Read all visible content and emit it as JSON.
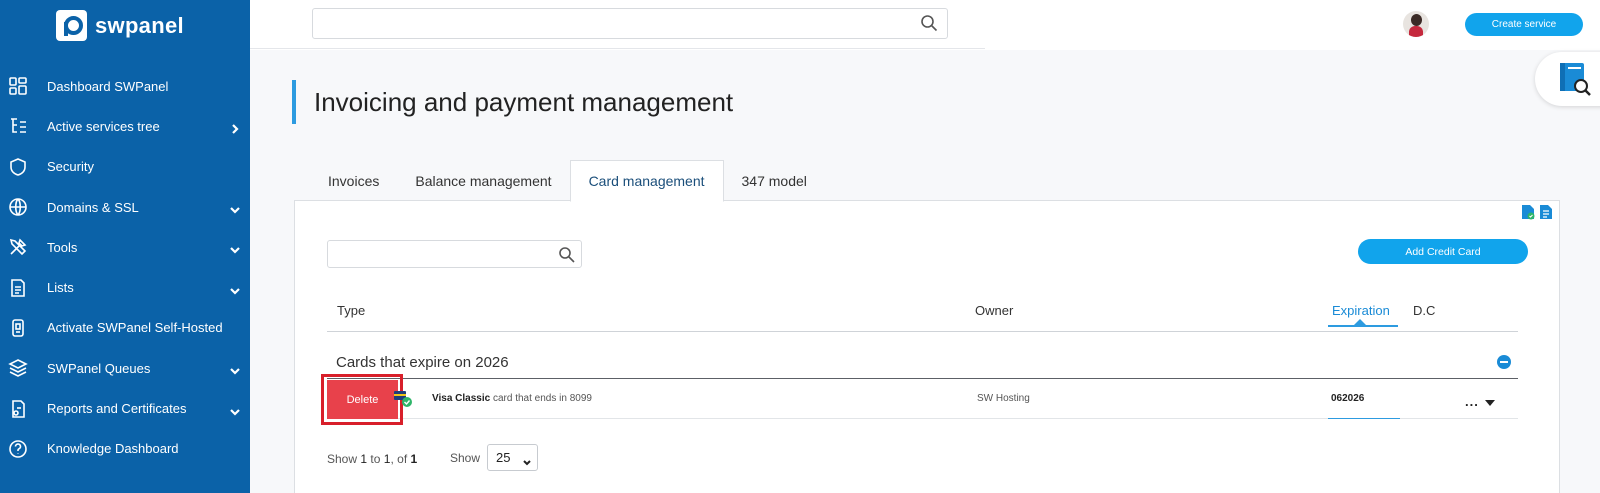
{
  "app": {
    "brand": "swpanel"
  },
  "sidebar": {
    "items": [
      {
        "label": "Dashboard SWPanel",
        "icon": "dashboard-icon",
        "arrow": "none"
      },
      {
        "label": "Active services tree",
        "icon": "tree-icon",
        "arrow": "right"
      },
      {
        "label": "Security",
        "icon": "shield-icon",
        "arrow": "none"
      },
      {
        "label": "Domains & SSL",
        "icon": "www-icon",
        "arrow": "down"
      },
      {
        "label": "Tools",
        "icon": "tools-icon",
        "arrow": "down"
      },
      {
        "label": "Lists",
        "icon": "list-icon",
        "arrow": "down"
      },
      {
        "label": "Activate SWPanel Self-Hosted",
        "icon": "self-hosted-icon",
        "arrow": "none"
      },
      {
        "label": "SWPanel Queues",
        "icon": "layers-icon",
        "arrow": "down"
      },
      {
        "label": "Reports and Certificates",
        "icon": "report-icon",
        "arrow": "down"
      },
      {
        "label": "Knowledge Dashboard",
        "icon": "help-icon",
        "arrow": "none"
      }
    ]
  },
  "topbar": {
    "search_placeholder": "",
    "create_service_label": "Create service"
  },
  "page": {
    "title": "Invoicing and payment management",
    "accent_color": "#2d9be0"
  },
  "tabs": [
    {
      "label": "Invoices",
      "active": false
    },
    {
      "label": "Balance management",
      "active": false
    },
    {
      "label": "Card management",
      "active": true
    },
    {
      "label": "347 model",
      "active": false
    }
  ],
  "cards": {
    "search_placeholder": "",
    "add_card_label": "Add Credit Card",
    "columns": {
      "type": "Type",
      "owner": "Owner",
      "expiration": "Expiration",
      "dc": "D.C"
    },
    "group_title": "Cards that expire on 2026",
    "rows": [
      {
        "delete_label": "Delete",
        "card_name": "Visa Classic",
        "card_suffix": "card that ends in 8099",
        "owner": "SW Hosting",
        "expiration": "062026",
        "actions": "..."
      }
    ]
  },
  "pagination": {
    "prefix": "Show",
    "from": "1",
    "to_word": "to",
    "to": "1",
    "of_word": "of",
    "total": "1",
    "show_label": "Show",
    "page_size": "25"
  },
  "colors": {
    "sidebar": "#0b62a8",
    "primary_button": "#11a4ec",
    "delete_button": "#e8414b",
    "delete_highlight": "#d81f2a"
  }
}
